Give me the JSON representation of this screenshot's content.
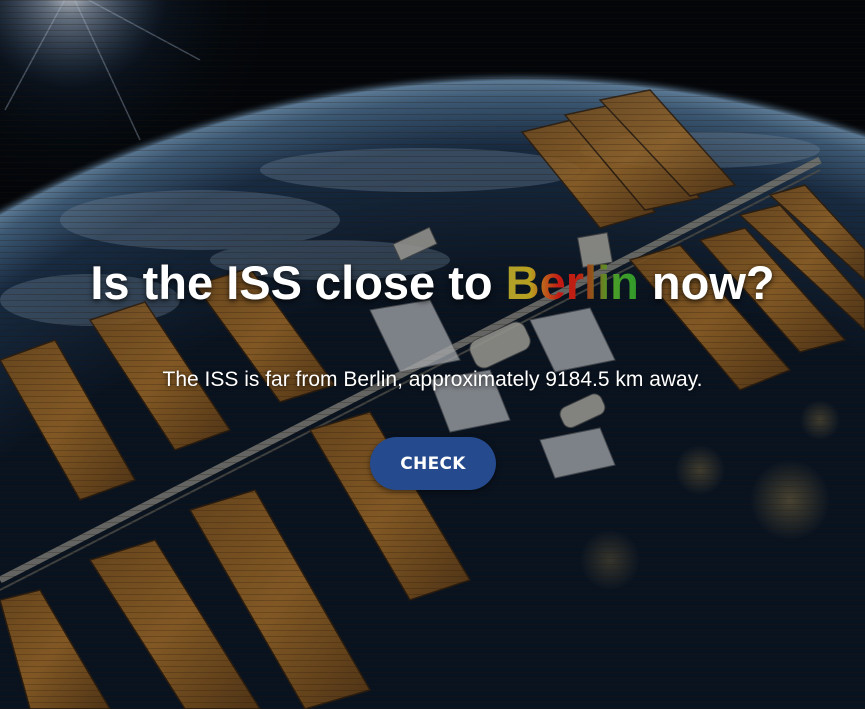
{
  "heading": {
    "before": "Is the ISS close to ",
    "city": "Berlin",
    "after": " now?"
  },
  "result_text": "The ISS is far from Berlin, approximately 9184.5 km away.",
  "check_button_label": "CHECK",
  "colors": {
    "button": "#254a8e",
    "city_gradient": [
      "#b8a020",
      "#c21a14",
      "#2e9a2a"
    ],
    "text": "#ffffff"
  },
  "background": {
    "image": "iss-over-earth-night"
  }
}
